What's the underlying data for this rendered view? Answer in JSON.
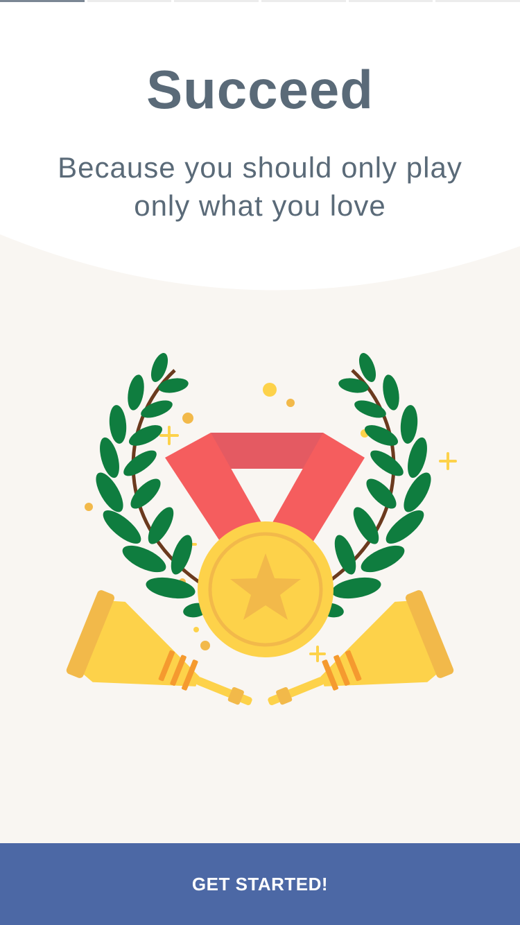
{
  "onboarding": {
    "title": "Succeed",
    "subtitle": "Because you should only play only what you love",
    "pages_total": 6,
    "page_active": 1
  },
  "illustration": {
    "depicts": "medal-with-laurels-and-trumpets"
  },
  "cta": {
    "label": "GET STARTED!"
  },
  "colors": {
    "title": "#5a6a78",
    "background_top": "#ffffff",
    "background_bottom": "#f9f6f2",
    "cta_background": "#4c68a5",
    "cta_text": "#ffffff",
    "medal": "#fdd24a",
    "ribbon": "#f55d5e",
    "laurel": "#0f7d3f"
  }
}
